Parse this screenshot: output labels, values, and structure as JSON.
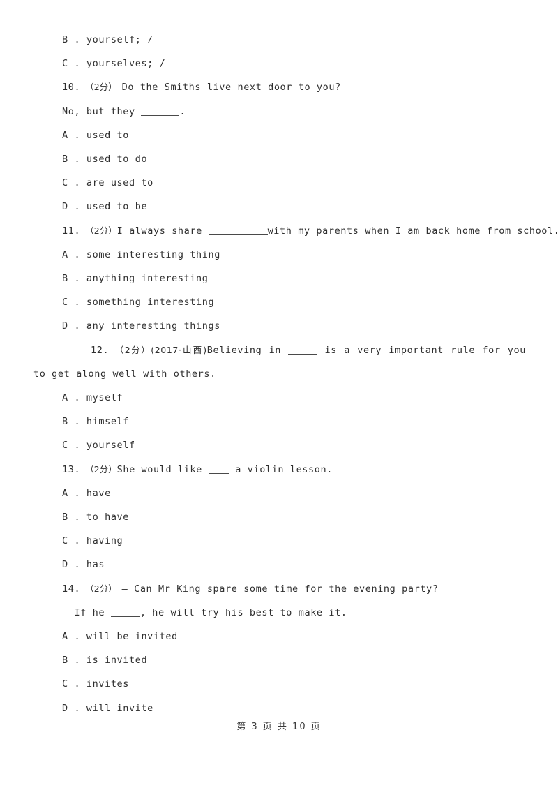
{
  "document": {
    "page_background": "#ffffff",
    "text_color": "#2f2f2f",
    "footer": "第 3 页 共 10 页",
    "page_number": "3",
    "total_pages": "10"
  },
  "lines": {
    "opt_9b": "B . yourself; /",
    "opt_9c": "C . yourselves; /",
    "q10_number": "10.",
    "q10_marks": "（2分）",
    "q10_stem": "Do the Smiths live next door to you?",
    "q10_prompt_before": "No, but they ",
    "q10_prompt_after": ".",
    "q10_a": "A . used to",
    "q10_b": "B . used to do",
    "q10_c": "C . are used to",
    "q10_d": "D . used to be",
    "q11_number": "11.",
    "q11_marks": "（2分）",
    "q11_stem_before": "I always share ",
    "q11_stem_after": "with my parents when I am back home from school.",
    "q11_a": "A . some interesting thing",
    "q11_b": "B . anything interesting",
    "q11_c": "C . something interesting",
    "q11_d": "D . any interesting things",
    "q12_number": "12.",
    "q12_marks": "（2分）",
    "q12_source": "(2017·山西)",
    "q12_stem_before": "Believing in ",
    "q12_stem_after": " is a very important rule for you to get along well with others.",
    "q12_a": "A . myself",
    "q12_b": "B . himself",
    "q12_c": "C . yourself",
    "q13_number": "13.",
    "q13_marks": "（2分）",
    "q13_stem_before": "She would like ",
    "q13_stem_after": " a violin lesson.",
    "q13_a": "A . have",
    "q13_b": "B . to have",
    "q13_c": "C . having",
    "q13_d": "D . has",
    "q14_number": "14.",
    "q14_marks": "（2分）",
    "q14_stem": "— Can Mr King spare some time for the evening party?",
    "q14_prompt_before": "— If he ",
    "q14_prompt_after": ", he will try his best to make it.",
    "q14_a": "A . will be invited",
    "q14_b": "B . is invited",
    "q14_c": "C . invites",
    "q14_d": "D . will invite"
  }
}
